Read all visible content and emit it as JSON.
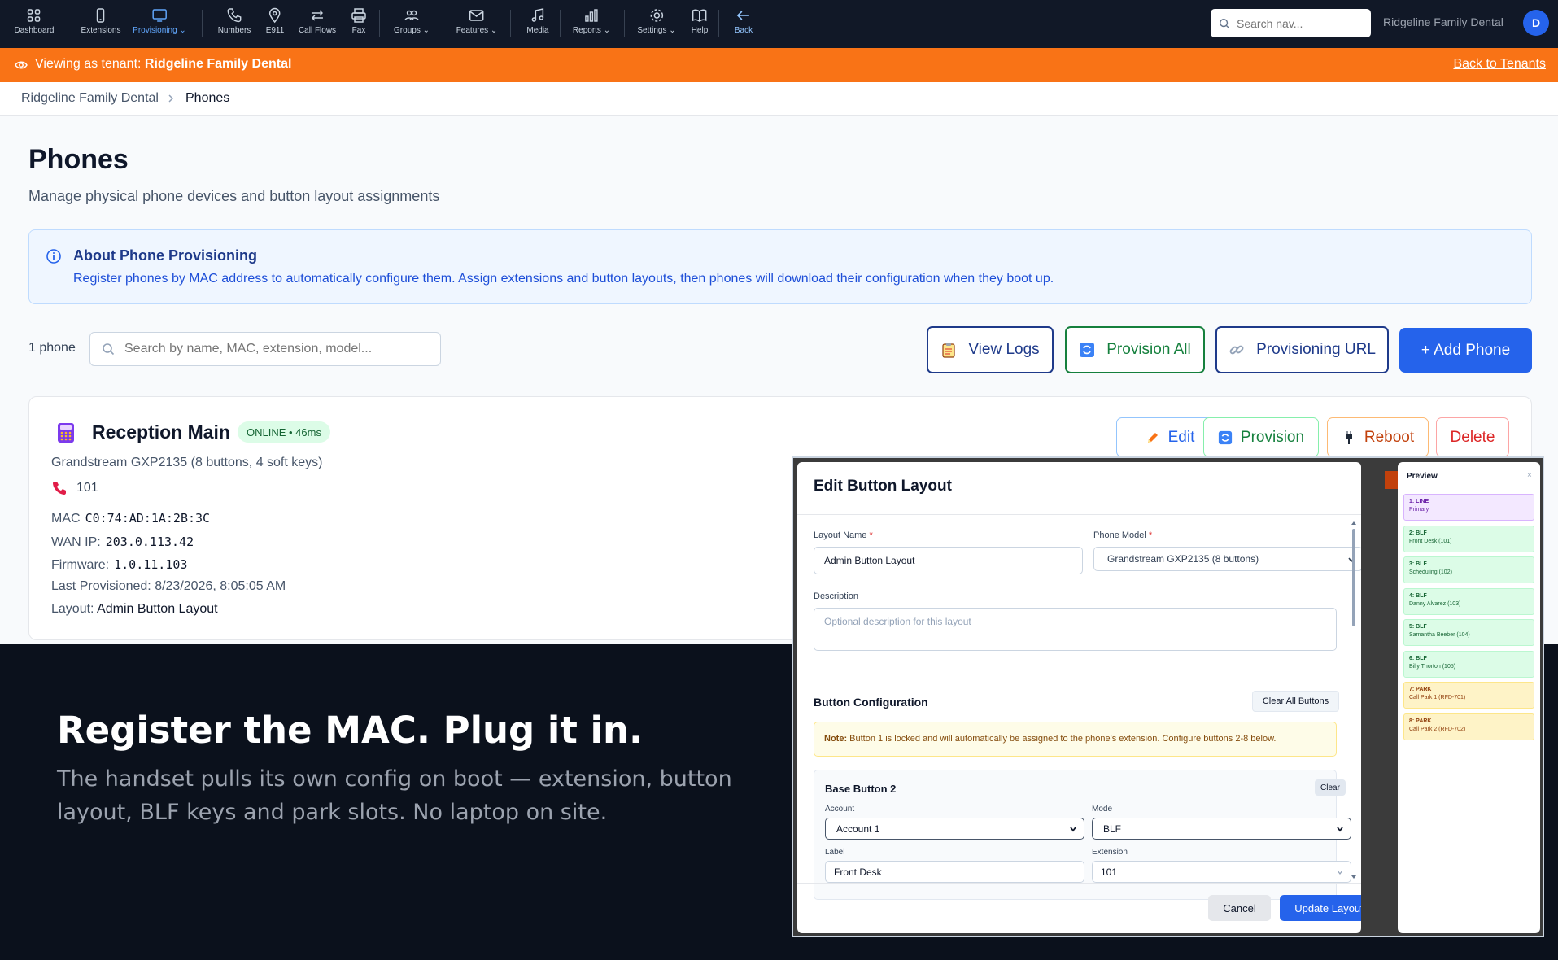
{
  "nav": {
    "items": [
      {
        "key": "dashboard",
        "label": "Dashboard",
        "icon": "grid-icon",
        "caret": false
      },
      {
        "key": "extensions",
        "label": "Extensions",
        "icon": "mobile-icon",
        "caret": false
      },
      {
        "key": "provisioning",
        "label": "Provisioning",
        "icon": "monitor-icon",
        "caret": true,
        "active": true
      },
      {
        "key": "numbers",
        "label": "Numbers",
        "icon": "phone-icon",
        "caret": false
      },
      {
        "key": "e911",
        "label": "E911",
        "icon": "map-pin-icon",
        "caret": false
      },
      {
        "key": "call-flows",
        "label": "Call Flows",
        "icon": "arrows-icon",
        "caret": false
      },
      {
        "key": "fax",
        "label": "Fax",
        "icon": "printer-icon",
        "caret": false
      },
      {
        "key": "groups",
        "label": "Groups",
        "icon": "users-icon",
        "caret": true
      },
      {
        "key": "features",
        "label": "Features",
        "icon": "mail-icon",
        "caret": true
      },
      {
        "key": "media",
        "label": "Media",
        "icon": "music-icon",
        "caret": false
      },
      {
        "key": "reports",
        "label": "Reports",
        "icon": "bar-chart-icon",
        "caret": true
      },
      {
        "key": "settings",
        "label": "Settings",
        "icon": "gear-icon",
        "caret": true
      },
      {
        "key": "help",
        "label": "Help",
        "icon": "book-icon",
        "caret": false
      },
      {
        "key": "back",
        "label": "Back",
        "icon": "arrow-left-icon",
        "caret": false
      }
    ],
    "search_placeholder": "Search nav...",
    "tenant": "Ridgeline Family Dental",
    "avatar_initial": "D"
  },
  "banner": {
    "prefix": "Viewing as tenant:",
    "tenant": "Ridgeline Family Dental",
    "back_link": "Back to Tenants"
  },
  "breadcrumb": {
    "parent": "Ridgeline Family Dental",
    "current": "Phones"
  },
  "page": {
    "title": "Phones",
    "subtitle": "Manage physical phone devices and button layout assignments"
  },
  "info": {
    "title": "About Phone Provisioning",
    "text": "Register phones by MAC address to automatically configure them. Assign extensions and button layouts, then phones will download their configuration when they boot up."
  },
  "toolbar": {
    "count": "1 phone",
    "search_placeholder": "Search by name, MAC, extension, model...",
    "view_logs": "View Logs",
    "provision_all": "Provision All",
    "provisioning_url": "Provisioning URL",
    "add_phone": "+ Add Phone"
  },
  "device": {
    "name": "Reception Main",
    "status": "ONLINE • 46ms",
    "model": "Grandstream GXP2135 (8 buttons, 4 soft keys)",
    "extension": "101",
    "mac_label": "MAC",
    "mac": "C0:74:AD:1A:2B:3C",
    "wan_label": "WAN IP:",
    "wan": "203.0.113.42",
    "fw_label": "Firmware:",
    "fw": "1.0.11.103",
    "prov_label": "Last Provisioned:",
    "prov": "8/23/2026, 8:05:05 AM",
    "layout_label": "Layout:",
    "layout": "Admin Button Layout",
    "actions": {
      "edit": "Edit",
      "provision": "Provision",
      "reboot": "Reboot",
      "delete": "Delete"
    }
  },
  "hero": {
    "headline": "Register the MAC. Plug it in.",
    "body": "The handset pulls its own config on boot — extension, button layout, BLF keys and park slots. No laptop on site."
  },
  "modal": {
    "title": "Edit Button Layout",
    "layout_name_label": "Layout Name",
    "layout_name": "Admin Button Layout",
    "phone_model_label": "Phone Model",
    "phone_model": "Grandstream GXP2135 (8 buttons)",
    "description_label": "Description",
    "description_placeholder": "Optional description for this layout",
    "button_config_title": "Button Configuration",
    "clear_all": "Clear All Buttons",
    "note_label": "Note:",
    "note_text": "Button 1 is locked and will automatically be assigned to the phone's extension. Configure buttons 2-8 below.",
    "base_button_title": "Base Button 2",
    "base_clear": "Clear",
    "account_label": "Account",
    "account": "Account 1",
    "mode_label": "Mode",
    "mode": "BLF",
    "label_label": "Label",
    "label": "Front Desk",
    "extension_label": "Extension",
    "extension": "101",
    "cancel": "Cancel",
    "update": "Update Layout"
  },
  "preview": {
    "title": "Preview",
    "close": "×",
    "keys": [
      {
        "key": "1: LINE",
        "sub": "Primary",
        "type": "line"
      },
      {
        "key": "2: BLF",
        "sub": "Front Desk (101)",
        "type": "blf"
      },
      {
        "key": "3: BLF",
        "sub": "Scheduling (102)",
        "type": "blf"
      },
      {
        "key": "4: BLF",
        "sub": "Danny Alvarez (103)",
        "type": "blf"
      },
      {
        "key": "5: BLF",
        "sub": "Samantha Beeber (104)",
        "type": "blf"
      },
      {
        "key": "6: BLF",
        "sub": "Billy Thorton (105)",
        "type": "blf"
      },
      {
        "key": "7: PARK",
        "sub": "Call Park 1 (RFD-701)",
        "type": "park"
      },
      {
        "key": "8: PARK",
        "sub": "Call Park 2 (RFD-702)",
        "type": "park"
      }
    ]
  },
  "colors": {
    "nav_bg": "#111827",
    "banner": "#f97316",
    "primary": "#2563eb",
    "success": "#15803d",
    "danger": "#dc2626",
    "line_key": "#f3e8ff",
    "blf_key": "#dcfce7",
    "park_key": "#fef3c7"
  }
}
